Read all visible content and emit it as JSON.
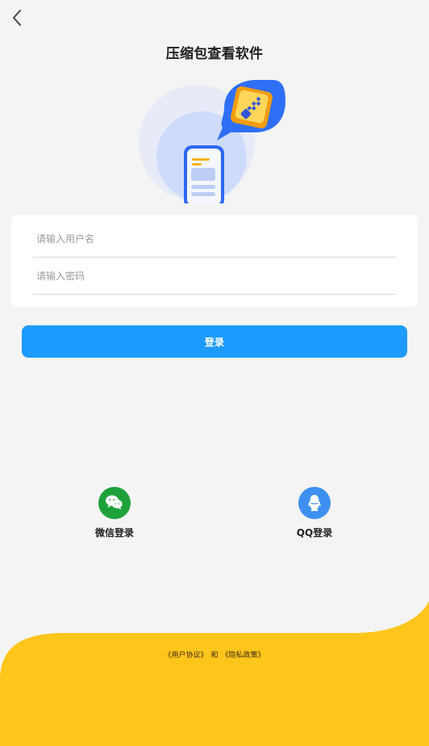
{
  "header": {
    "title": "压缩包查看软件"
  },
  "form": {
    "username_placeholder": "请输入用户名",
    "password_placeholder": "请输入密码"
  },
  "actions": {
    "login_label": "登录"
  },
  "social": {
    "wechat_label": "微信登录",
    "qq_label": "QQ登录"
  },
  "footer": {
    "user_agreement": "《用户协议》",
    "and": "和",
    "privacy_policy": "《隐私政策》"
  },
  "icons": {
    "back": "chevron-left-icon",
    "hero": "phone-chat-zip-illustration",
    "wechat": "wechat-icon",
    "qq": "qq-icon"
  },
  "colors": {
    "primary": "#1e9bff",
    "background": "#f4f4f4",
    "wechat": "#1ea13b",
    "qq": "#3e90f0",
    "footer": "#ffc51b"
  }
}
